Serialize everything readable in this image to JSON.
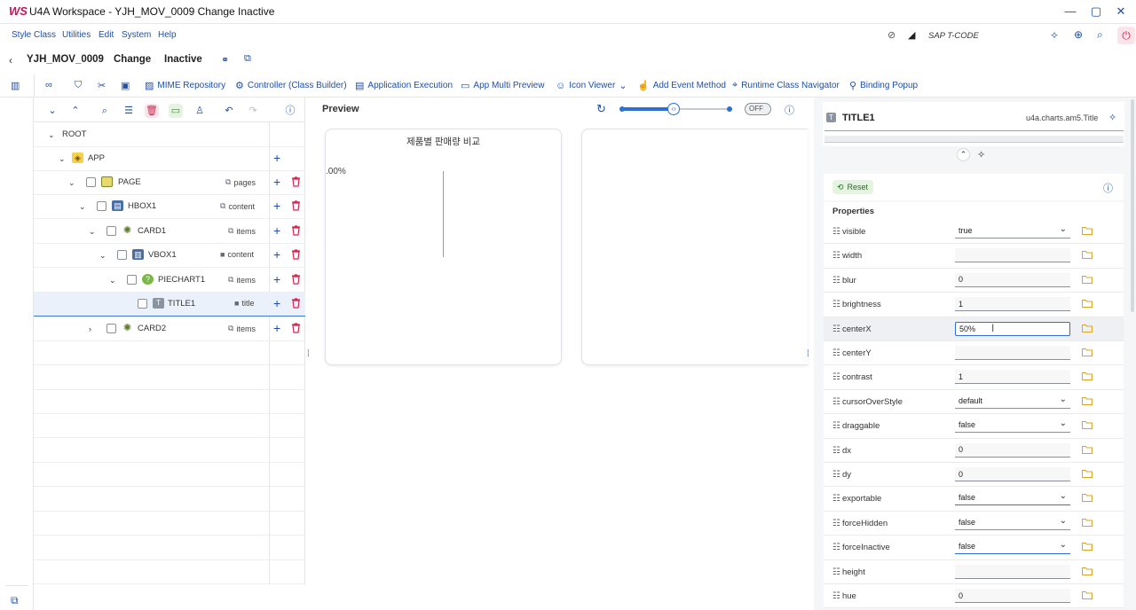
{
  "window": {
    "title": "U4A Workspace - YJH_MOV_0009 Change Inactive",
    "logo": "WS"
  },
  "menu": {
    "items": [
      "Style Class",
      "Utilities",
      "Edit",
      "System",
      "Help"
    ],
    "tcode_label": "SAP T-CODE"
  },
  "header": {
    "app_id": "YJH_MOV_0009",
    "mode": "Change",
    "status": "Inactive"
  },
  "toolbar": {
    "mime": "MIME Repository",
    "controller": "Controller (Class Builder)",
    "app_exec": "Application Execution",
    "multi_preview": "App Multi Preview",
    "icon_viewer": "Icon Viewer",
    "add_event": "Add Event Method",
    "runtime_nav": "Runtime Class Navigator",
    "binding_popup": "Binding Popup"
  },
  "tree": {
    "rows": [
      {
        "label": "ROOT",
        "agg": "",
        "expanded": true
      },
      {
        "label": "APP",
        "agg": "",
        "expanded": true
      },
      {
        "label": "PAGE",
        "agg": "pages",
        "expanded": true
      },
      {
        "label": "HBOX1",
        "agg": "content",
        "expanded": true
      },
      {
        "label": "CARD1",
        "agg": "items",
        "expanded": true
      },
      {
        "label": "VBOX1",
        "agg": "content",
        "expanded": true
      },
      {
        "label": "PIECHART1",
        "agg": "items",
        "expanded": true
      },
      {
        "label": "TITLE1",
        "agg": "title",
        "expanded": false
      },
      {
        "label": "CARD2",
        "agg": "items",
        "expanded": false
      }
    ]
  },
  "preview": {
    "title": "Preview",
    "toggle": "OFF",
    "chart_title": "제품별 판매량 비교",
    "percent_label": ".00%"
  },
  "props": {
    "element": "TITLE1",
    "class_name": "u4a.charts.am5.Title",
    "reset": "Reset",
    "section": "Properties",
    "rows": [
      {
        "name": "visible",
        "value": "true",
        "kind": "select"
      },
      {
        "name": "width",
        "value": "",
        "kind": "input"
      },
      {
        "name": "blur",
        "value": "0",
        "kind": "input"
      },
      {
        "name": "brightness",
        "value": "1",
        "kind": "input"
      },
      {
        "name": "centerX",
        "value": "50%",
        "kind": "input"
      },
      {
        "name": "centerY",
        "value": "",
        "kind": "input"
      },
      {
        "name": "contrast",
        "value": "1",
        "kind": "input"
      },
      {
        "name": "cursorOverStyle",
        "value": "default",
        "kind": "select"
      },
      {
        "name": "draggable",
        "value": "false",
        "kind": "select"
      },
      {
        "name": "dx",
        "value": "0",
        "kind": "input"
      },
      {
        "name": "dy",
        "value": "0",
        "kind": "input"
      },
      {
        "name": "exportable",
        "value": "false",
        "kind": "select"
      },
      {
        "name": "forceHidden",
        "value": "false",
        "kind": "select"
      },
      {
        "name": "forceInactive",
        "value": "false",
        "kind": "select"
      },
      {
        "name": "height",
        "value": "",
        "kind": "input"
      },
      {
        "name": "hue",
        "value": "0",
        "kind": "input"
      }
    ]
  }
}
